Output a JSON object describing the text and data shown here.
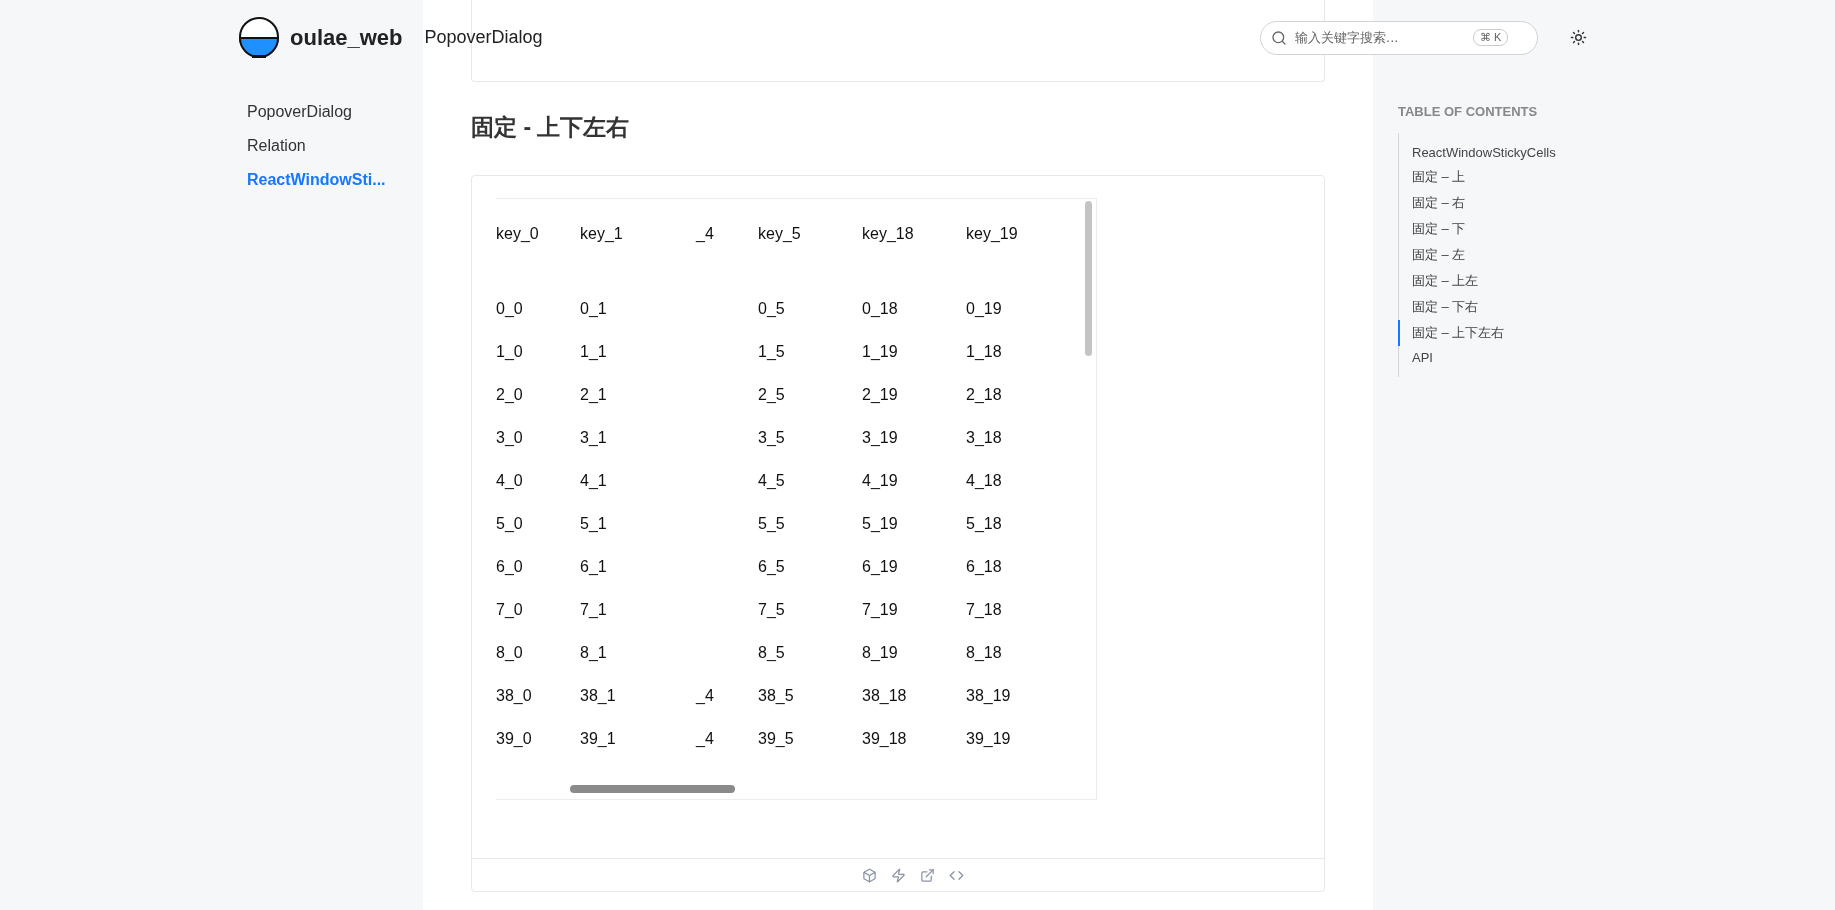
{
  "header": {
    "site_name": "oulae_web",
    "page_title": "PopoverDialog",
    "search": {
      "placeholder": "输入关键字搜索...",
      "shortcut": "⌘ K"
    }
  },
  "sidebar": {
    "items": [
      {
        "label": "PopoverDialog",
        "selected": false
      },
      {
        "label": "Relation",
        "selected": false
      },
      {
        "label": "ReactWindowSti...",
        "selected": true
      }
    ]
  },
  "section": {
    "heading": "固定 - 上下左右"
  },
  "table": {
    "header": [
      "key_0",
      "key_1",
      "_4",
      "key_5",
      "key_18",
      "key_19"
    ],
    "rows": [
      [
        "0_0",
        "0_1",
        "",
        "0_5",
        "0_18",
        "0_19"
      ],
      [
        "1_0",
        "1_1",
        "",
        "1_5",
        "1_19",
        "1_18"
      ],
      [
        "2_0",
        "2_1",
        "",
        "2_5",
        "2_19",
        "2_18"
      ],
      [
        "3_0",
        "3_1",
        "",
        "3_5",
        "3_19",
        "3_18"
      ],
      [
        "4_0",
        "4_1",
        "",
        "4_5",
        "4_19",
        "4_18"
      ],
      [
        "5_0",
        "5_1",
        "",
        "5_5",
        "5_19",
        "5_18"
      ],
      [
        "6_0",
        "6_1",
        "",
        "6_5",
        "6_19",
        "6_18"
      ],
      [
        "7_0",
        "7_1",
        "",
        "7_5",
        "7_19",
        "7_18"
      ],
      [
        "8_0",
        "8_1",
        "",
        "8_5",
        "8_19",
        "8_18"
      ],
      [
        "38_0",
        "38_1",
        "_4",
        "38_5",
        "38_18",
        "38_19"
      ],
      [
        "39_0",
        "39_1",
        "_4",
        "39_5",
        "39_18",
        "39_19"
      ]
    ]
  },
  "toc": {
    "title": "TABLE OF CONTENTS",
    "items": [
      {
        "label": "ReactWindowStickyCells",
        "selected": false
      },
      {
        "label": "固定 – 上",
        "selected": false
      },
      {
        "label": "固定 – 右",
        "selected": false
      },
      {
        "label": "固定 – 下",
        "selected": false
      },
      {
        "label": "固定 – 左",
        "selected": false
      },
      {
        "label": "固定 – 上左",
        "selected": false
      },
      {
        "label": "固定 – 下右",
        "selected": false
      },
      {
        "label": "固定 – 上下左右",
        "selected": true
      },
      {
        "label": "API",
        "selected": false
      }
    ]
  }
}
